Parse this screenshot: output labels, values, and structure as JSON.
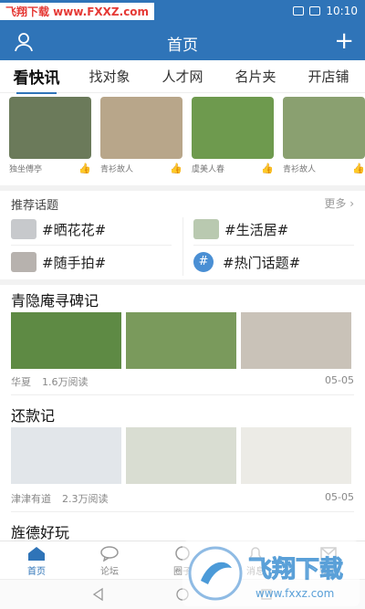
{
  "watermark_top": "飞翔下载 www.FXXZ.com",
  "status": {
    "time": "10:10"
  },
  "header": {
    "title": "首页"
  },
  "tabs": [
    "看快讯",
    "找对象",
    "人才网",
    "名片夹",
    "开店铺"
  ],
  "strip": [
    {
      "author": "独坐傅亭",
      "color": "#6b7a5a"
    },
    {
      "author": "青衫故人",
      "color": "#b8a68a"
    },
    {
      "author": "虞美人春",
      "color": "#6e9a4e"
    },
    {
      "author": "青衫故人",
      "color": "#8aa070"
    }
  ],
  "topics": {
    "heading": "推荐话题",
    "more": "更多",
    "items": [
      "#晒花花#",
      "#生活居#",
      "#随手拍#",
      "#热门话题#"
    ]
  },
  "posts": [
    {
      "title": "青隐庵寻碑记",
      "author": "华夏",
      "reads": "1.6万阅读",
      "date": "05-05",
      "colors": [
        "#5e8a44",
        "#7a9a5c",
        "#c9c2b8"
      ]
    },
    {
      "title": "还款记",
      "author": "津津有道",
      "reads": "2.3万阅读",
      "date": "05-05",
      "colors": [
        "#e2e6ea",
        "#d9ddd2",
        "#ecebe6"
      ]
    },
    {
      "title": "旌德好玩"
    }
  ],
  "nav": [
    "首页",
    "论坛",
    "圈子",
    "消息",
    "我的"
  ],
  "watermark_bottom": {
    "title": "飞翔下载",
    "url": "www.fxxz.com"
  }
}
